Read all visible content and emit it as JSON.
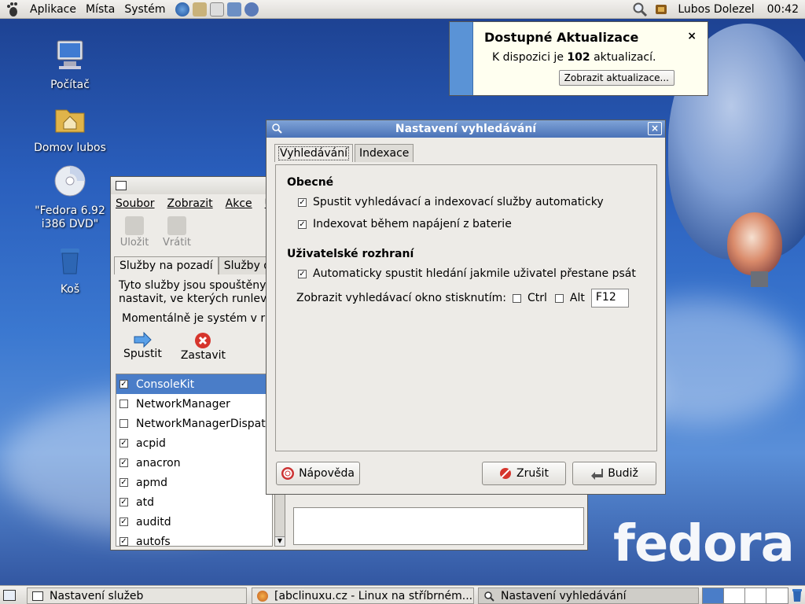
{
  "top_panel": {
    "menus": [
      "Aplikace",
      "Místa",
      "Systém"
    ],
    "user": "Lubos Dolezel",
    "clock": "00:42"
  },
  "desktop": {
    "icons": [
      {
        "label": "Počítač"
      },
      {
        "label": "Domov lubos"
      },
      {
        "label": "\"Fedora 6.92 i386 DVD\""
      },
      {
        "label": "Koš"
      }
    ],
    "logo_text": "fedora"
  },
  "notification": {
    "title": "Dostupné Aktualizace",
    "body_prefix": "K dispozici je ",
    "count": "102",
    "body_suffix": " aktualizací.",
    "close": "×",
    "button": "Zobrazit aktualizace..."
  },
  "services_window": {
    "menu": [
      "Soubor",
      "Zobrazit",
      "Akce",
      "U"
    ],
    "toolbar": [
      "Uložit",
      "Vrátit"
    ],
    "tabs": [
      "Služby na pozadí",
      "Služby dle"
    ],
    "desc_line1": "Tyto služby jsou spouštěny r",
    "desc_line2": "nastavit, ve kterých runleve",
    "status": "Momentálně je systém v ru",
    "actions": [
      "Spustit",
      "Zastavit"
    ],
    "services": [
      {
        "name": "ConsoleKit",
        "checked": true,
        "selected": true
      },
      {
        "name": "NetworkManager",
        "checked": false
      },
      {
        "name": "NetworkManagerDispatc",
        "checked": false
      },
      {
        "name": "acpid",
        "checked": true
      },
      {
        "name": "anacron",
        "checked": true
      },
      {
        "name": "apmd",
        "checked": true
      },
      {
        "name": "atd",
        "checked": true
      },
      {
        "name": "auditd",
        "checked": true
      },
      {
        "name": "autofs",
        "checked": true
      }
    ]
  },
  "search_dialog": {
    "title": "Nastavení vyhledávání",
    "close": "×",
    "tabs": [
      "Vyhledávání",
      "Indexace"
    ],
    "general_title": "Obecné",
    "opt_autostart": "Spustit vyhledávací a indexovací služby automaticky",
    "opt_battery": "Indexovat během napájení z baterie",
    "ui_title": "Uživatelské rozhraní",
    "opt_auto_search": "Automaticky spustit hledání jakmile uživatel přestane psát",
    "shortcut_label": "Zobrazit vyhledávací okno stisknutím:",
    "ctrl_label": "Ctrl",
    "alt_label": "Alt",
    "key_value": "F12",
    "help_button": "Nápověda",
    "cancel_button": "Zrušit",
    "ok_button": "Budiž"
  },
  "taskbar": {
    "tasks": [
      "Nastavení služeb",
      "[abclinuxu.cz - Linux na stříbrném...",
      "Nastavení vyhledávání"
    ]
  },
  "colors": {
    "titlebar_active": "#4a72b7",
    "selection": "#4a7dc8",
    "notify_stripe": "#5a93d6"
  }
}
